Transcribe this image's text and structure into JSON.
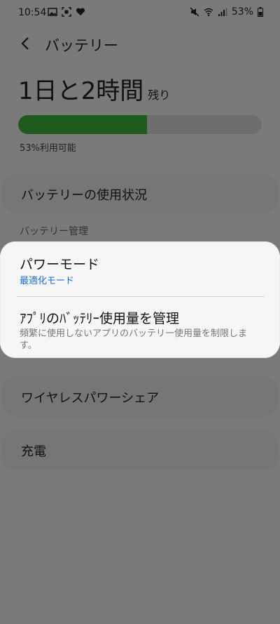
{
  "status_bar": {
    "time": "10:54",
    "battery_percent": "53%",
    "icons_left": [
      "image-icon",
      "screenshot-icon",
      "heart-icon"
    ],
    "icons_right": [
      "mute-icon",
      "wifi-icon",
      "signal-icon",
      "battery-icon"
    ]
  },
  "header": {
    "back_icon": "back-arrow-icon",
    "title": "バッテリー"
  },
  "battery": {
    "time_left": "1日と2時間",
    "time_suffix": "残り",
    "level_percent": 53,
    "available_text": "53%利用可能",
    "fill_color": "#1f5a1f"
  },
  "usage_card": {
    "label": "バッテリーの使用状況"
  },
  "section": {
    "title": "バッテリー管理"
  },
  "sheet": {
    "power_mode": {
      "title": "パワーモード",
      "value": "最適化モード"
    },
    "manage_apps": {
      "title": "ｱﾌﾟﾘのﾊﾞｯﾃﾘｰ使用量を管理",
      "description": "頻繁に使用しないアプリのバッテリー使用量を制限します。"
    }
  },
  "wireless_card": {
    "label": "ワイヤレスパワーシェア"
  },
  "charging_card": {
    "label": "充電"
  },
  "colors": {
    "overlay_bg": "#7a7a7a",
    "sheet_bg": "#f6f6f6",
    "accent_blue": "#1a6fd0"
  }
}
